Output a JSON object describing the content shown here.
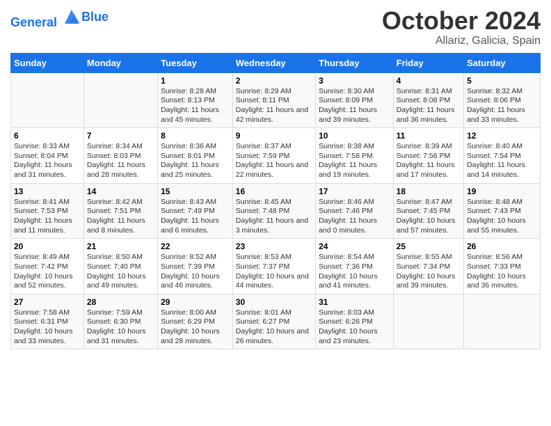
{
  "header": {
    "logo_line1": "General",
    "logo_line2": "Blue",
    "title": "October 2024",
    "subtitle": "Allariz, Galicia, Spain"
  },
  "weekdays": [
    "Sunday",
    "Monday",
    "Tuesday",
    "Wednesday",
    "Thursday",
    "Friday",
    "Saturday"
  ],
  "weeks": [
    [
      {
        "day": "",
        "info": ""
      },
      {
        "day": "",
        "info": ""
      },
      {
        "day": "1",
        "info": "Sunrise: 8:28 AM\nSunset: 8:13 PM\nDaylight: 11 hours and 45 minutes."
      },
      {
        "day": "2",
        "info": "Sunrise: 8:29 AM\nSunset: 8:11 PM\nDaylight: 11 hours and 42 minutes."
      },
      {
        "day": "3",
        "info": "Sunrise: 8:30 AM\nSunset: 8:09 PM\nDaylight: 11 hours and 39 minutes."
      },
      {
        "day": "4",
        "info": "Sunrise: 8:31 AM\nSunset: 8:08 PM\nDaylight: 11 hours and 36 minutes."
      },
      {
        "day": "5",
        "info": "Sunrise: 8:32 AM\nSunset: 8:06 PM\nDaylight: 11 hours and 33 minutes."
      }
    ],
    [
      {
        "day": "6",
        "info": "Sunrise: 8:33 AM\nSunset: 8:04 PM\nDaylight: 11 hours and 31 minutes."
      },
      {
        "day": "7",
        "info": "Sunrise: 8:34 AM\nSunset: 8:03 PM\nDaylight: 11 hours and 28 minutes."
      },
      {
        "day": "8",
        "info": "Sunrise: 8:36 AM\nSunset: 8:01 PM\nDaylight: 11 hours and 25 minutes."
      },
      {
        "day": "9",
        "info": "Sunrise: 8:37 AM\nSunset: 7:59 PM\nDaylight: 11 hours and 22 minutes."
      },
      {
        "day": "10",
        "info": "Sunrise: 8:38 AM\nSunset: 7:58 PM\nDaylight: 11 hours and 19 minutes."
      },
      {
        "day": "11",
        "info": "Sunrise: 8:39 AM\nSunset: 7:56 PM\nDaylight: 11 hours and 17 minutes."
      },
      {
        "day": "12",
        "info": "Sunrise: 8:40 AM\nSunset: 7:54 PM\nDaylight: 11 hours and 14 minutes."
      }
    ],
    [
      {
        "day": "13",
        "info": "Sunrise: 8:41 AM\nSunset: 7:53 PM\nDaylight: 11 hours and 11 minutes."
      },
      {
        "day": "14",
        "info": "Sunrise: 8:42 AM\nSunset: 7:51 PM\nDaylight: 11 hours and 8 minutes."
      },
      {
        "day": "15",
        "info": "Sunrise: 8:43 AM\nSunset: 7:49 PM\nDaylight: 11 hours and 6 minutes."
      },
      {
        "day": "16",
        "info": "Sunrise: 8:45 AM\nSunset: 7:48 PM\nDaylight: 11 hours and 3 minutes."
      },
      {
        "day": "17",
        "info": "Sunrise: 8:46 AM\nSunset: 7:46 PM\nDaylight: 11 hours and 0 minutes."
      },
      {
        "day": "18",
        "info": "Sunrise: 8:47 AM\nSunset: 7:45 PM\nDaylight: 10 hours and 57 minutes."
      },
      {
        "day": "19",
        "info": "Sunrise: 8:48 AM\nSunset: 7:43 PM\nDaylight: 10 hours and 55 minutes."
      }
    ],
    [
      {
        "day": "20",
        "info": "Sunrise: 8:49 AM\nSunset: 7:42 PM\nDaylight: 10 hours and 52 minutes."
      },
      {
        "day": "21",
        "info": "Sunrise: 8:50 AM\nSunset: 7:40 PM\nDaylight: 10 hours and 49 minutes."
      },
      {
        "day": "22",
        "info": "Sunrise: 8:52 AM\nSunset: 7:39 PM\nDaylight: 10 hours and 46 minutes."
      },
      {
        "day": "23",
        "info": "Sunrise: 8:53 AM\nSunset: 7:37 PM\nDaylight: 10 hours and 44 minutes."
      },
      {
        "day": "24",
        "info": "Sunrise: 8:54 AM\nSunset: 7:36 PM\nDaylight: 10 hours and 41 minutes."
      },
      {
        "day": "25",
        "info": "Sunrise: 8:55 AM\nSunset: 7:34 PM\nDaylight: 10 hours and 39 minutes."
      },
      {
        "day": "26",
        "info": "Sunrise: 8:56 AM\nSunset: 7:33 PM\nDaylight: 10 hours and 36 minutes."
      }
    ],
    [
      {
        "day": "27",
        "info": "Sunrise: 7:58 AM\nSunset: 6:31 PM\nDaylight: 10 hours and 33 minutes."
      },
      {
        "day": "28",
        "info": "Sunrise: 7:59 AM\nSunset: 6:30 PM\nDaylight: 10 hours and 31 minutes."
      },
      {
        "day": "29",
        "info": "Sunrise: 8:00 AM\nSunset: 6:29 PM\nDaylight: 10 hours and 28 minutes."
      },
      {
        "day": "30",
        "info": "Sunrise: 8:01 AM\nSunset: 6:27 PM\nDaylight: 10 hours and 26 minutes."
      },
      {
        "day": "31",
        "info": "Sunrise: 8:03 AM\nSunset: 6:26 PM\nDaylight: 10 hours and 23 minutes."
      },
      {
        "day": "",
        "info": ""
      },
      {
        "day": "",
        "info": ""
      }
    ]
  ]
}
